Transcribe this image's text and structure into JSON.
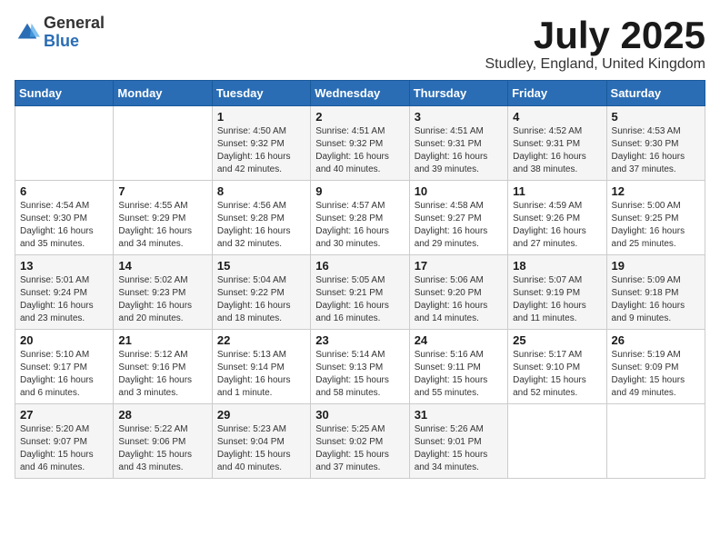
{
  "logo": {
    "general": "General",
    "blue": "Blue"
  },
  "title": "July 2025",
  "location": "Studley, England, United Kingdom",
  "headers": [
    "Sunday",
    "Monday",
    "Tuesday",
    "Wednesday",
    "Thursday",
    "Friday",
    "Saturday"
  ],
  "weeks": [
    [
      {
        "day": "",
        "info": ""
      },
      {
        "day": "",
        "info": ""
      },
      {
        "day": "1",
        "info": "Sunrise: 4:50 AM\nSunset: 9:32 PM\nDaylight: 16 hours\nand 42 minutes."
      },
      {
        "day": "2",
        "info": "Sunrise: 4:51 AM\nSunset: 9:32 PM\nDaylight: 16 hours\nand 40 minutes."
      },
      {
        "day": "3",
        "info": "Sunrise: 4:51 AM\nSunset: 9:31 PM\nDaylight: 16 hours\nand 39 minutes."
      },
      {
        "day": "4",
        "info": "Sunrise: 4:52 AM\nSunset: 9:31 PM\nDaylight: 16 hours\nand 38 minutes."
      },
      {
        "day": "5",
        "info": "Sunrise: 4:53 AM\nSunset: 9:30 PM\nDaylight: 16 hours\nand 37 minutes."
      }
    ],
    [
      {
        "day": "6",
        "info": "Sunrise: 4:54 AM\nSunset: 9:30 PM\nDaylight: 16 hours\nand 35 minutes."
      },
      {
        "day": "7",
        "info": "Sunrise: 4:55 AM\nSunset: 9:29 PM\nDaylight: 16 hours\nand 34 minutes."
      },
      {
        "day": "8",
        "info": "Sunrise: 4:56 AM\nSunset: 9:28 PM\nDaylight: 16 hours\nand 32 minutes."
      },
      {
        "day": "9",
        "info": "Sunrise: 4:57 AM\nSunset: 9:28 PM\nDaylight: 16 hours\nand 30 minutes."
      },
      {
        "day": "10",
        "info": "Sunrise: 4:58 AM\nSunset: 9:27 PM\nDaylight: 16 hours\nand 29 minutes."
      },
      {
        "day": "11",
        "info": "Sunrise: 4:59 AM\nSunset: 9:26 PM\nDaylight: 16 hours\nand 27 minutes."
      },
      {
        "day": "12",
        "info": "Sunrise: 5:00 AM\nSunset: 9:25 PM\nDaylight: 16 hours\nand 25 minutes."
      }
    ],
    [
      {
        "day": "13",
        "info": "Sunrise: 5:01 AM\nSunset: 9:24 PM\nDaylight: 16 hours\nand 23 minutes."
      },
      {
        "day": "14",
        "info": "Sunrise: 5:02 AM\nSunset: 9:23 PM\nDaylight: 16 hours\nand 20 minutes."
      },
      {
        "day": "15",
        "info": "Sunrise: 5:04 AM\nSunset: 9:22 PM\nDaylight: 16 hours\nand 18 minutes."
      },
      {
        "day": "16",
        "info": "Sunrise: 5:05 AM\nSunset: 9:21 PM\nDaylight: 16 hours\nand 16 minutes."
      },
      {
        "day": "17",
        "info": "Sunrise: 5:06 AM\nSunset: 9:20 PM\nDaylight: 16 hours\nand 14 minutes."
      },
      {
        "day": "18",
        "info": "Sunrise: 5:07 AM\nSunset: 9:19 PM\nDaylight: 16 hours\nand 11 minutes."
      },
      {
        "day": "19",
        "info": "Sunrise: 5:09 AM\nSunset: 9:18 PM\nDaylight: 16 hours\nand 9 minutes."
      }
    ],
    [
      {
        "day": "20",
        "info": "Sunrise: 5:10 AM\nSunset: 9:17 PM\nDaylight: 16 hours\nand 6 minutes."
      },
      {
        "day": "21",
        "info": "Sunrise: 5:12 AM\nSunset: 9:16 PM\nDaylight: 16 hours\nand 3 minutes."
      },
      {
        "day": "22",
        "info": "Sunrise: 5:13 AM\nSunset: 9:14 PM\nDaylight: 16 hours\nand 1 minute."
      },
      {
        "day": "23",
        "info": "Sunrise: 5:14 AM\nSunset: 9:13 PM\nDaylight: 15 hours\nand 58 minutes."
      },
      {
        "day": "24",
        "info": "Sunrise: 5:16 AM\nSunset: 9:11 PM\nDaylight: 15 hours\nand 55 minutes."
      },
      {
        "day": "25",
        "info": "Sunrise: 5:17 AM\nSunset: 9:10 PM\nDaylight: 15 hours\nand 52 minutes."
      },
      {
        "day": "26",
        "info": "Sunrise: 5:19 AM\nSunset: 9:09 PM\nDaylight: 15 hours\nand 49 minutes."
      }
    ],
    [
      {
        "day": "27",
        "info": "Sunrise: 5:20 AM\nSunset: 9:07 PM\nDaylight: 15 hours\nand 46 minutes."
      },
      {
        "day": "28",
        "info": "Sunrise: 5:22 AM\nSunset: 9:06 PM\nDaylight: 15 hours\nand 43 minutes."
      },
      {
        "day": "29",
        "info": "Sunrise: 5:23 AM\nSunset: 9:04 PM\nDaylight: 15 hours\nand 40 minutes."
      },
      {
        "day": "30",
        "info": "Sunrise: 5:25 AM\nSunset: 9:02 PM\nDaylight: 15 hours\nand 37 minutes."
      },
      {
        "day": "31",
        "info": "Sunrise: 5:26 AM\nSunset: 9:01 PM\nDaylight: 15 hours\nand 34 minutes."
      },
      {
        "day": "",
        "info": ""
      },
      {
        "day": "",
        "info": ""
      }
    ]
  ]
}
